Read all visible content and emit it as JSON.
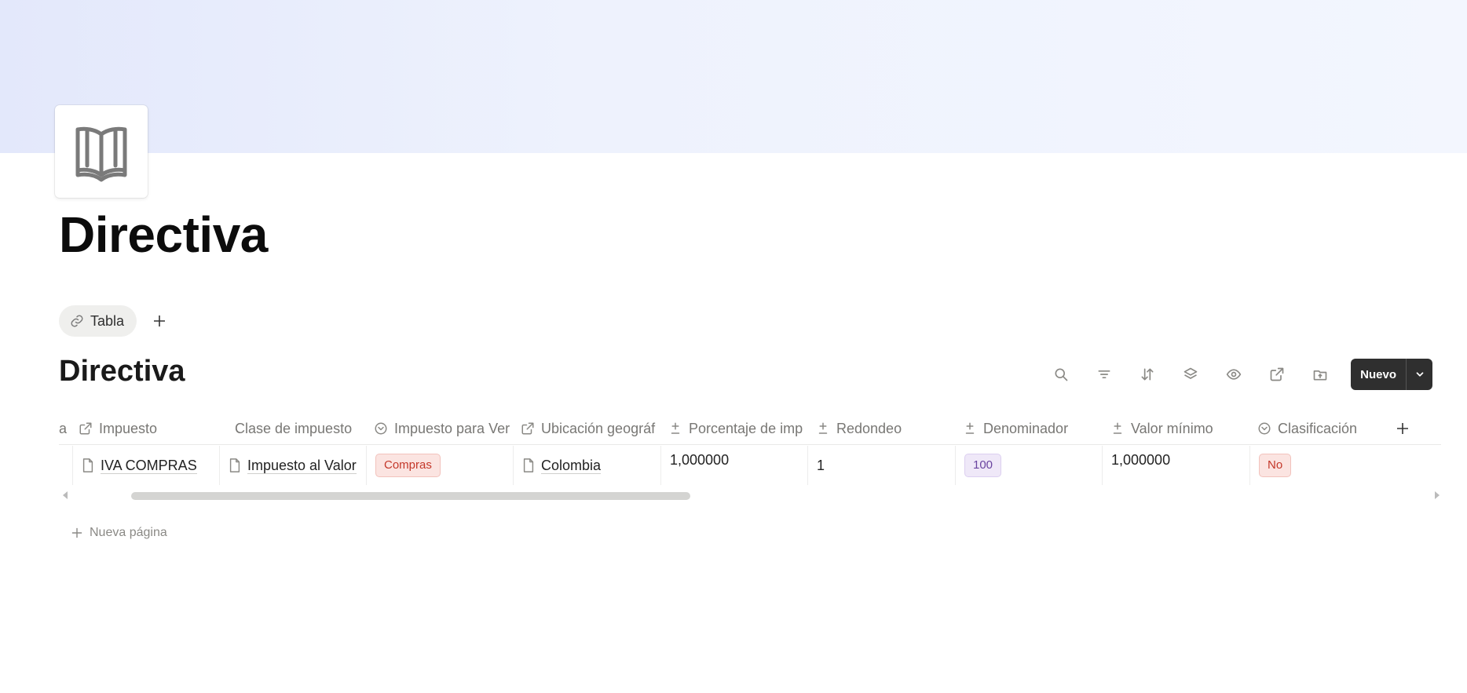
{
  "page": {
    "title": "Directiva",
    "cover_colors": [
      "#e3e8fb",
      "#f3f6fe"
    ],
    "icon": "open-book-icon"
  },
  "views": {
    "active_tab": {
      "label": "Tabla",
      "icon": "link-icon"
    },
    "add_view_icon": "plus-icon"
  },
  "database": {
    "title": "Directiva",
    "toolbar": {
      "icons": [
        "search-icon",
        "filter-icon",
        "sort-icon",
        "group-icon",
        "visibility-icon",
        "external-link-icon",
        "archive-icon"
      ],
      "new_label": "Nuevo",
      "new_dropdown_icon": "chevron-down-icon"
    },
    "columns": [
      {
        "label": "a",
        "icon": ""
      },
      {
        "label": "Impuesto",
        "icon": "relation-icon"
      },
      {
        "label": "Clase de impuesto",
        "icon": ""
      },
      {
        "label": "Impuesto para Ver",
        "icon": "select-icon"
      },
      {
        "label": "Ubicación geográf",
        "icon": "relation-icon"
      },
      {
        "label": "Porcentaje de imp",
        "icon": "number-icon"
      },
      {
        "label": "Redondeo",
        "icon": "number-icon"
      },
      {
        "label": "Denominador",
        "icon": "number-icon"
      },
      {
        "label": "Valor mínimo",
        "icon": "number-icon"
      },
      {
        "label": "Clasificación",
        "icon": "select-icon"
      }
    ],
    "add_column_icon": "plus-icon",
    "rows": [
      {
        "impuesto": "IVA COMPRAS",
        "clase_de_impuesto": "Impuesto al Valor",
        "impuesto_para_ventas": "Compras",
        "ubicacion_geografica": "Colombia",
        "porcentaje_de_impuesto": "1,000000",
        "redondeo": "1",
        "denominador": "100",
        "valor_minimo": "1,000000",
        "clasificacion": "No"
      }
    ],
    "new_page_label": "Nueva página",
    "tag_colors": {
      "red": "#fbe4e1",
      "purple": "#efe8f8"
    }
  }
}
